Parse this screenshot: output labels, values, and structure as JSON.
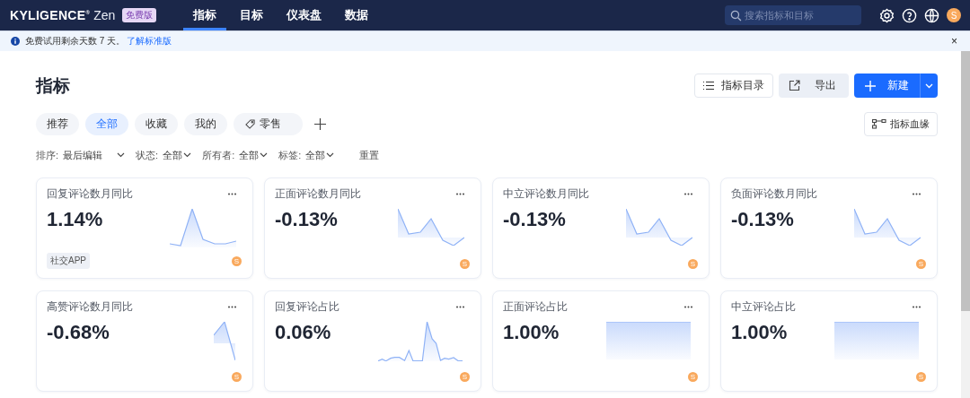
{
  "top_nav": {
    "logo": {
      "brand": "KYLIGENCE$^{®}$",
      "product": "Zen",
      "badge": "免费版"
    },
    "items": [
      {
        "label": "指标",
        "selected": true
      },
      {
        "label": "目标",
        "selected": false
      },
      {
        "label": "仪表盘",
        "selected": false
      },
      {
        "label": "数据",
        "selected": false
      }
    ],
    "search": {
      "placeholder": "搜索指标和目标"
    },
    "avatar": "S"
  },
  "notice": {
    "text": "免费试用剩余天数 7 天。",
    "link": "了解标准版",
    "close": "×"
  },
  "page": {
    "title": "指标",
    "buttons": [
      {
        "kind": "catalog",
        "label": "指标目录"
      },
      {
        "kind": "export",
        "label": "导出"
      },
      {
        "kind": "create",
        "label": "新建"
      }
    ]
  },
  "chips": [
    {
      "label": "推荐",
      "selected": false
    },
    {
      "label": "全部",
      "selected": true
    },
    {
      "label": "收藏",
      "selected": false
    },
    {
      "label": "我的",
      "selected": false
    },
    {
      "label": "零售",
      "selected": false,
      "kind": "tag"
    }
  ],
  "lineage_button": "指标血缘",
  "filters": [
    {
      "label": "排序:",
      "value": "最后编辑"
    },
    {
      "label": "状态:",
      "value": "全部"
    },
    {
      "label": "所有者:",
      "value": "全部"
    },
    {
      "label": "标签:",
      "value": "全部"
    }
  ],
  "reset": "重置",
  "cards": [
    {
      "title": "回复评论数月同比",
      "value": "1.14%",
      "tag": "社交APP",
      "owner": "S"
    },
    {
      "title": "正面评论数月同比",
      "value": "-0.13%",
      "owner": "S"
    },
    {
      "title": "中立评论数月同比",
      "value": "-0.13%",
      "owner": "S"
    },
    {
      "title": "负面评论数月同比",
      "value": "-0.13%",
      "owner": "S"
    },
    {
      "title": "高赞评论数月同比",
      "value": "-0.68%",
      "owner": "S"
    },
    {
      "title": "回复评论占比",
      "value": "0.06%",
      "owner": "S"
    },
    {
      "title": "正面评论占比",
      "value": "1.00%",
      "owner": "S"
    },
    {
      "title": "中立评论占比",
      "value": "1.00%",
      "owner": "S"
    }
  ]
}
